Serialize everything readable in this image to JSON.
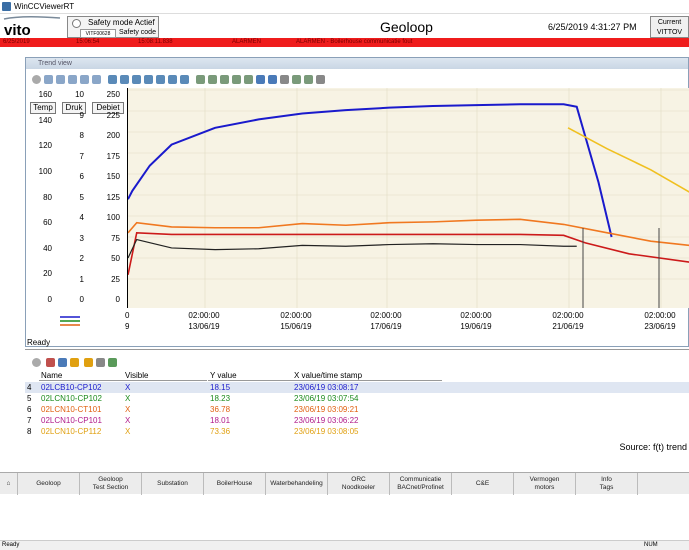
{
  "window": {
    "title": "WinCCViewerRT"
  },
  "header": {
    "logo": "vito",
    "safety_mode_label": "Safety mode Actief",
    "safety_code_value": "VITF00628",
    "safety_code_label": "Safety code",
    "app_title": "Geoloop",
    "datetime": "6/25/2019 4:31:27 PM",
    "user_label": "Current",
    "user_value": "VITTOV"
  },
  "alarm_bar": {
    "date": "6/25/2019",
    "time1": "15:06:54",
    "time2": "15:08:11.838",
    "status": "ALARMEN",
    "message": "ALARMEN - Boilerhouse communicatie fout"
  },
  "trend_window": {
    "title": "Trend view",
    "axes": [
      {
        "name": "Temp",
        "ticks": [
          "160",
          "140",
          "120",
          "100",
          "80",
          "60",
          "40",
          "20",
          "0"
        ]
      },
      {
        "name": "Druk",
        "ticks": [
          "10",
          "9",
          "8",
          "7",
          "6",
          "5",
          "4",
          "3",
          "2",
          "1",
          "0"
        ]
      },
      {
        "name": "Debiet",
        "ticks": [
          "250",
          "225",
          "200",
          "175",
          "150",
          "125",
          "100",
          "75",
          "50",
          "25",
          "0"
        ]
      }
    ],
    "x_ticks": [
      {
        "time": "0",
        "date": "9"
      },
      {
        "time": "02:00:00",
        "date": "13/06/19"
      },
      {
        "time": "02:00:00",
        "date": "15/06/19"
      },
      {
        "time": "02:00:00",
        "date": "17/06/19"
      },
      {
        "time": "02:00:00",
        "date": "19/06/19"
      },
      {
        "time": "02:00:00",
        "date": "21/06/19"
      },
      {
        "time": "02:00:00",
        "date": "23/06/19"
      }
    ],
    "status": "Ready",
    "colors": {
      "blue": "#1a1acc",
      "orange": "#f07820",
      "red": "#cc1a1a",
      "gold": "#f0c020",
      "black": "#222222",
      "plot_bg": "#f7f3e4"
    }
  },
  "chart_data": {
    "type": "line",
    "x_range": [
      "11/06/19",
      "24/06/19"
    ],
    "y_axis_debiet": [
      0,
      250
    ],
    "series": [
      {
        "color": "blue",
        "x_days": [
          0.0,
          0.1,
          0.5,
          1.0,
          2.0,
          3.0,
          4.0,
          5.0,
          6.0,
          7.0,
          8.0,
          9.0,
          10.0,
          10.3,
          10.8,
          11.1
        ],
        "values": [
          120,
          130,
          160,
          185,
          205,
          215,
          222,
          226,
          229,
          231,
          232,
          233,
          233,
          230,
          140,
          75
        ]
      },
      {
        "color": "orange",
        "x_days": [
          0.0,
          0.2,
          1.0,
          2.0,
          3.0,
          4.0,
          5.0,
          6.0,
          7.0,
          8.0,
          9.0,
          10.0,
          11.0,
          12.0,
          12.9
        ],
        "values": [
          80,
          92,
          87,
          86,
          86,
          91,
          89,
          92,
          93,
          95,
          96,
          90,
          80,
          70,
          65
        ]
      },
      {
        "color": "red",
        "x_days": [
          0.0,
          0.2,
          1.0,
          3.0,
          5.0,
          7.0,
          9.0,
          10.0,
          10.5,
          11.5,
          12.9
        ],
        "values": [
          30,
          80,
          78,
          78,
          78,
          78,
          78,
          77,
          68,
          55,
          45
        ]
      },
      {
        "color": "black",
        "x_days": [
          0.0,
          0.2,
          1.0,
          2.0,
          3.0,
          4.0,
          5.0,
          6.0,
          7.0,
          8.0,
          9.0,
          10.0,
          10.3
        ],
        "values": [
          50,
          72,
          62,
          60,
          61,
          65,
          64,
          66,
          67,
          66,
          66,
          64,
          64
        ]
      },
      {
        "color": "gold",
        "x_days": [
          10.1,
          11.0,
          12.0,
          12.9
        ],
        "values": [
          205,
          180,
          155,
          128
        ]
      }
    ]
  },
  "table": {
    "headers": [
      "Name",
      "Visible",
      "Y value",
      "X value/time stamp"
    ],
    "rows": [
      {
        "idx": "4",
        "name": "02LCB10-CP102",
        "visible": "X",
        "y": "18.15",
        "x": "23/06/19 03:08:17",
        "color": "#1a1acc"
      },
      {
        "idx": "5",
        "name": "02LCN10-CP102",
        "visible": "X",
        "y": "18.23",
        "x": "23/06/19 03:07:54",
        "color": "#1a8a1a"
      },
      {
        "idx": "6",
        "name": "02LCN10-CT101",
        "visible": "X",
        "y": "36.78",
        "x": "23/06/19 03:09:21",
        "color": "#e06010"
      },
      {
        "idx": "7",
        "name": "02LCN10-CP101",
        "visible": "X",
        "y": "18.01",
        "x": "23/06/19 03:06:22",
        "color": "#b01a8a"
      },
      {
        "idx": "8",
        "name": "02LCN10-CP112",
        "visible": "X",
        "y": "73.36",
        "x": "23/06/19 03:08:05",
        "color": "#e0a010"
      }
    ],
    "source": "Source: f(t) trend"
  },
  "nav": {
    "items": [
      "Geoloop",
      "Geoloop\nTest Section",
      "Substation",
      "BoilerHouse",
      "Waterbehandeling",
      "ORC\nNoodkoeler",
      "Communicatie\nBACnet/Profinet",
      "C&E",
      "Vermogen\nmotors",
      "Info\nTags"
    ]
  },
  "status_bar": {
    "left": "Ready",
    "right": "NUM"
  }
}
